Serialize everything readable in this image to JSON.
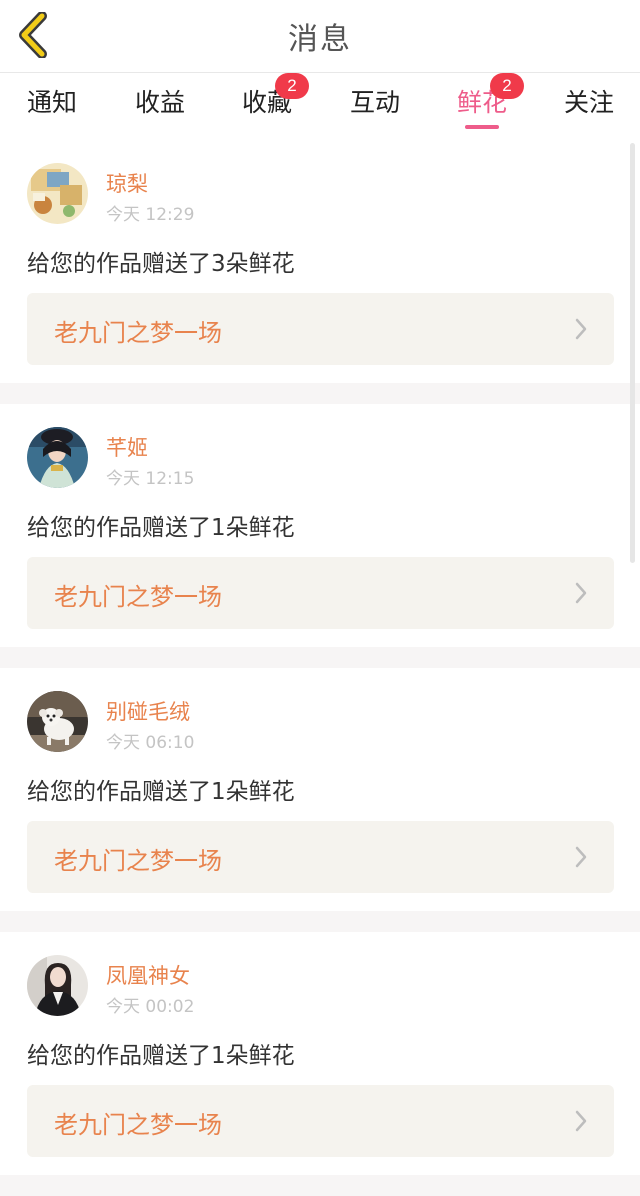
{
  "header": {
    "title": "消息",
    "back_icon": "chevron-left-icon"
  },
  "tabs": [
    {
      "label": "通知",
      "active": false
    },
    {
      "label": "收益",
      "active": false
    },
    {
      "label": "收藏",
      "active": false,
      "badge": "2"
    },
    {
      "label": "互动",
      "active": false
    },
    {
      "label": "鲜花",
      "active": true,
      "badge": "2"
    },
    {
      "label": "关注",
      "active": false
    }
  ],
  "messages": [
    {
      "username": "琼梨",
      "time": "今天 12:29",
      "text": "给您的作品赠送了3朵鲜花",
      "work_title": "老九门之梦一场",
      "avatar": "avatar-collage-icon"
    },
    {
      "username": "芊姬",
      "time": "今天 12:15",
      "text": "给您的作品赠送了1朵鲜花",
      "work_title": "老九门之梦一场",
      "avatar": "avatar-costume-girl-icon"
    },
    {
      "username": "别碰毛绒",
      "time": "今天 06:10",
      "text": "给您的作品赠送了1朵鲜花",
      "work_title": "老九门之梦一场",
      "avatar": "avatar-white-dog-icon"
    },
    {
      "username": "凤凰神女",
      "time": "今天 00:02",
      "text": "给您的作品赠送了1朵鲜花",
      "work_title": "老九门之梦一场",
      "avatar": "avatar-woman-portrait-icon"
    }
  ],
  "colors": {
    "accent": "#ee5c8a",
    "name": "#e8834d",
    "badge": "#f03a4a",
    "back_icon": "#e8c316"
  }
}
